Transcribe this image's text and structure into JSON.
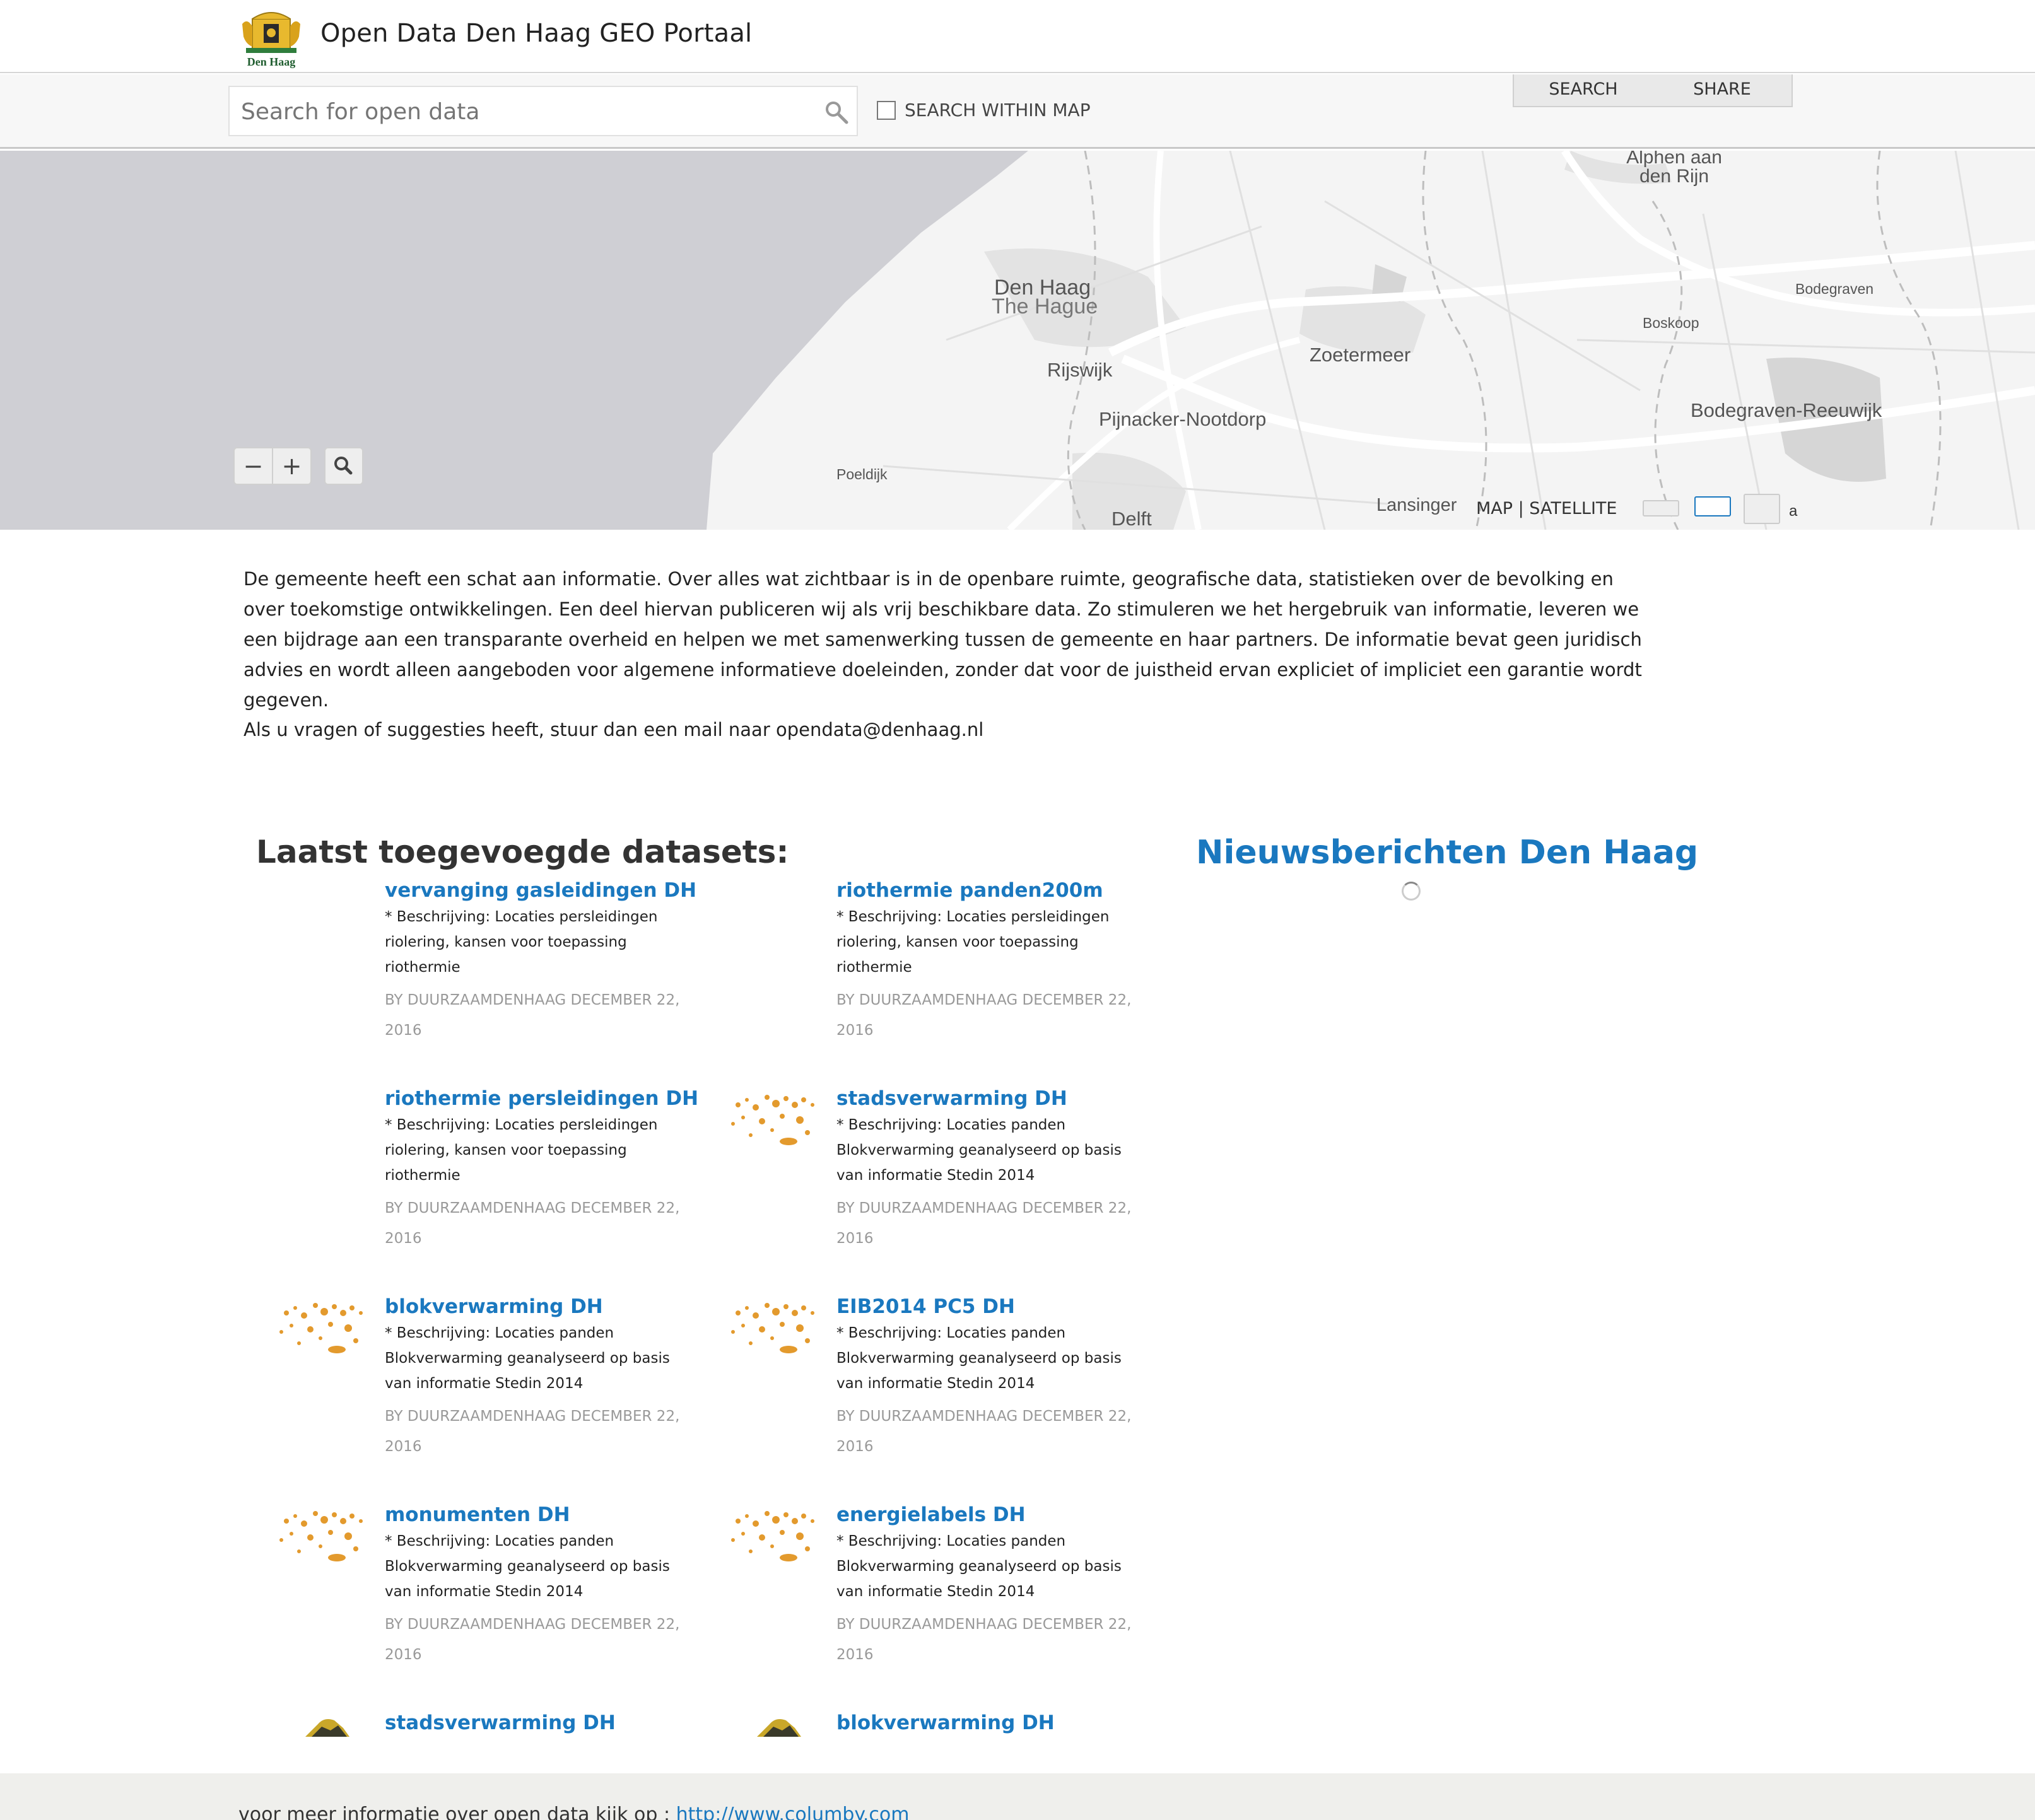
{
  "header": {
    "logo_caption": "Den Haag",
    "title": "Open Data Den Haag GEO Portaal"
  },
  "search": {
    "placeholder": "Search for open data",
    "within_map_label": "SEARCH WITHIN MAP",
    "within_map_checked": false
  },
  "tabs": [
    {
      "label": "SEARCH"
    },
    {
      "label": "SHARE"
    }
  ],
  "map": {
    "places": [
      "Alphen aan den Rijn",
      "Den Haag",
      "The Hague",
      "Bodegraven",
      "Boskoop",
      "Zoetermeer",
      "Rijswijk",
      "Pijnacker-Nootdorp",
      "Bodegraven-Reeuwijk",
      "Poeldijk",
      "Lansinger",
      "Delft"
    ],
    "zoom_out": "−",
    "zoom_in": "+",
    "map_type": "MAP | SATELLITE",
    "basemap_fragment": "a"
  },
  "intro": {
    "text": "De gemeente heeft een schat aan informatie. Over alles wat zichtbaar is in de openbare ruimte, geografische data, statistieken over de bevolking en over toekomstige ontwikkelingen. Een deel hiervan publiceren wij als vrij beschikbare data. Zo stimuleren we het hergebruik van informatie, leveren we een bijdrage aan een transparante overheid en helpen we met samenwerking tussen de gemeente en haar partners. De informatie bevat geen juridisch advies en wordt alleen aangeboden voor algemene informatieve doeleinden, zonder dat voor de juistheid ervan expliciet of impliciet een garantie wordt gegeven.",
    "contact": "Als u vragen of suggesties heeft, stuur dan een mail naar opendata@denhaag.nl"
  },
  "datasets_heading": "Laatst toegevoegde datasets:",
  "news_heading": "Nieuwsberichten Den Haag",
  "datasets": [
    {
      "title": "vervanging gasleidingen DH",
      "description": "* Beschrijving: Locaties persleidingen riolering, kansen voor toepassing riothermie",
      "meta": "BY DUURZAAMDENHAAG DECEMBER 22, 2016",
      "thumb": "none"
    },
    {
      "title": "riothermie panden200m",
      "description": "* Beschrijving: Locaties persleidingen riolering, kansen voor toepassing riothermie",
      "meta": "BY DUURZAAMDENHAAG DECEMBER 22, 2016",
      "thumb": "none"
    },
    {
      "title": "riothermie persleidingen DH",
      "description": "* Beschrijving: Locaties persleidingen riolering, kansen voor toepassing riothermie",
      "meta": "BY DUURZAAMDENHAAG DECEMBER 22, 2016",
      "thumb": "none"
    },
    {
      "title": "stadsverwarming DH",
      "description": "* Beschrijving: Locaties panden Blokverwarming geanalyseerd op basis van informatie Stedin 2014",
      "meta": "BY DUURZAAMDENHAAG DECEMBER 22, 2016",
      "thumb": "orange-dots"
    },
    {
      "title": "blokverwarming DH",
      "description": "* Beschrijving: Locaties panden Blokverwarming geanalyseerd op basis van informatie Stedin 2014",
      "meta": "BY DUURZAAMDENHAAG DECEMBER 22, 2016",
      "thumb": "orange-dots"
    },
    {
      "title": "EIB2014 PC5 DH",
      "description": "* Beschrijving: Locaties panden Blokverwarming geanalyseerd op basis van informatie Stedin 2014",
      "meta": "BY DUURZAAMDENHAAG DECEMBER 22, 2016",
      "thumb": "orange-dots"
    },
    {
      "title": "monumenten DH",
      "description": "* Beschrijving: Locaties panden Blokverwarming geanalyseerd op basis van informatie Stedin 2014",
      "meta": "BY DUURZAAMDENHAAG DECEMBER 22, 2016",
      "thumb": "orange-dots"
    },
    {
      "title": "energielabels DH",
      "description": "* Beschrijving: Locaties panden Blokverwarming geanalyseerd op basis van informatie Stedin 2014",
      "meta": "BY DUURZAAMDENHAAG DECEMBER 22, 2016",
      "thumb": "orange-dots"
    },
    {
      "title": "stadsverwarming DH",
      "description": "",
      "meta": "",
      "thumb": "yellow-terrain"
    },
    {
      "title": "blokverwarming DH",
      "description": "",
      "meta": "",
      "thumb": "yellow-terrain"
    }
  ],
  "footer": {
    "text": "voor meer informatie over open data kijk op :",
    "link": "http://www.columby.com"
  },
  "colors": {
    "link": "#1a78bf",
    "sea": "#cfcfd4",
    "land": "#f4f4f4",
    "footer": "#efefec"
  }
}
